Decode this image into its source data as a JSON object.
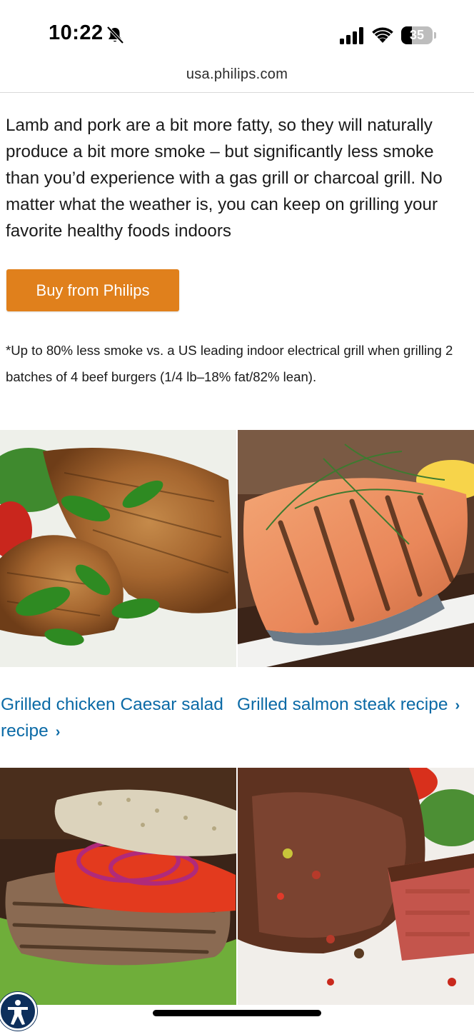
{
  "status_bar": {
    "time": "10:22",
    "battery_level": "35",
    "battery_fraction": 0.35,
    "icons": [
      "bell-slash-icon",
      "cellular-signal-icon",
      "wifi-icon",
      "battery-icon"
    ]
  },
  "browser": {
    "url": "usa.philips.com"
  },
  "article": {
    "paragraph": "Lamb and pork are a bit more fatty, so they will naturally produce a bit more smoke – but significantly less smoke than you’d experience with a gas grill or charcoal grill. No matter what the weather is, you can keep on grilling your favorite healthy foods indoors",
    "buy_button_label": "Buy from Philips",
    "footnote": "*Up to 80% less smoke vs. a US leading indoor electrical grill when grilling 2 batches of 4 beef burgers (1/4 lb–18% fat/82% lean)."
  },
  "recipes": [
    {
      "label": "Grilled chicken Caesar salad recipe",
      "chevron": "›",
      "image": "grilled-chicken-image"
    },
    {
      "label": "Grilled salmon steak recipe",
      "chevron": "›",
      "image": "grilled-salmon-image"
    },
    {
      "image": "burger-image"
    },
    {
      "image": "steak-image"
    }
  ],
  "colors": {
    "accent_button": "#e0801c",
    "link": "#0b6aa6",
    "accessibility_button": "#0d2f5c"
  }
}
